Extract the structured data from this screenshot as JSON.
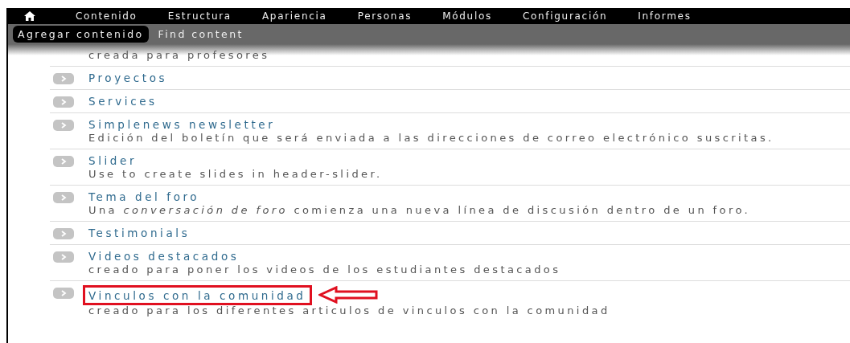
{
  "toolbar": {
    "menu": [
      {
        "label": "Contenido"
      },
      {
        "label": "Estructura"
      },
      {
        "label": "Apariencia"
      },
      {
        "label": "Personas"
      },
      {
        "label": "Módulos"
      },
      {
        "label": "Configuración"
      },
      {
        "label": "Informes"
      }
    ]
  },
  "shortcuts": [
    {
      "label": "Agregar contenido",
      "selected": true
    },
    {
      "label": "Find content",
      "selected": false
    }
  ],
  "content_types": [
    {
      "description": "creada para profesores"
    },
    {
      "title": "Proyectos",
      "highlighted": false
    },
    {
      "title": "Services",
      "highlighted": false
    },
    {
      "title": "Simplenews newsletter",
      "description": "Edición del boletín que será enviada a las direcciones de correo electrónico suscritas.",
      "highlighted": false
    },
    {
      "title": "Slider",
      "description": "Use to create slides in header-slider.",
      "highlighted": false
    },
    {
      "title": "Tema del foro",
      "description": "Una *conversación de foro* comienza una nueva línea de discusión dentro de un foro.",
      "highlighted": false
    },
    {
      "title": "Testimonials",
      "highlighted": false
    },
    {
      "title": "Videos destacados",
      "description": "creado para poner los videos de los estudiantes destacados",
      "highlighted": false
    },
    {
      "title": "Vinculos con la comunidad",
      "description": "creado para los diferentes articulos de vinculos con la comunidad",
      "highlighted": true
    }
  ]
}
